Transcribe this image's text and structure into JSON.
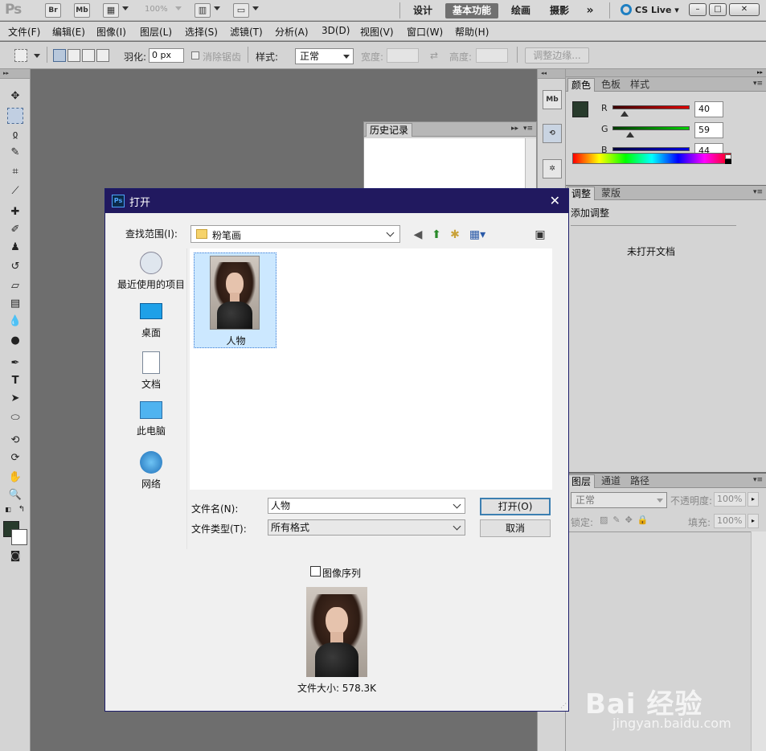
{
  "app": {
    "logo": "Ps",
    "bridge_btn": "Br",
    "mini_bridge_btn": "Mb",
    "zoom": "100%",
    "workspaces": [
      "设计",
      "基本功能",
      "绘画",
      "摄影"
    ],
    "workspace_more": "»",
    "cs_live": "CS Live"
  },
  "menu": [
    "文件(F)",
    "编辑(E)",
    "图像(I)",
    "图层(L)",
    "选择(S)",
    "滤镜(T)",
    "分析(A)",
    "3D(D)",
    "视图(V)",
    "窗口(W)",
    "帮助(H)"
  ],
  "options": {
    "feather_label": "羽化:",
    "feather_value": "0 px",
    "antialias_label": "消除锯齿",
    "style_label": "样式:",
    "style_value": "正常",
    "width_label": "宽度:",
    "height_label": "高度:",
    "refine_edge": "调整边缘..."
  },
  "panels": {
    "color_tabs": [
      "颜色",
      "色板",
      "样式"
    ],
    "rgb": [
      {
        "label": "R",
        "value": "40",
        "fraction": 0.157
      },
      {
        "label": "G",
        "value": "59",
        "fraction": 0.231
      },
      {
        "label": "B",
        "value": "44",
        "fraction": 0.173
      }
    ],
    "fg_color": "#283b2c",
    "adjust_tabs": [
      "调整",
      "蒙版"
    ],
    "adjust_title": "添加调整",
    "no_document": "未打开文档",
    "layer_tabs": [
      "图层",
      "通道",
      "路径"
    ],
    "blend_mode": "正常",
    "opacity_label": "不透明度:",
    "opacity_value": "100%",
    "lock_label": "锁定:",
    "fill_label": "填充:",
    "fill_value": "100%",
    "history_title": "历史记录"
  },
  "dialog": {
    "title": "打开",
    "look_in_label": "查找范围(I):",
    "look_in_value": "粉笔画",
    "places": [
      "最近使用的项目",
      "桌面",
      "文档",
      "此电脑",
      "网络"
    ],
    "files": [
      {
        "name": "人物"
      }
    ],
    "filename_label": "文件名(N):",
    "filename_value": "人物",
    "filetype_label": "文件类型(T):",
    "filetype_value": "所有格式",
    "open_button": "打开(O)",
    "cancel_button": "取消",
    "image_sequence": "图像序列",
    "file_size": "文件大小: 578.3K"
  },
  "watermark": {
    "main": "Bai 经验",
    "sub": "jingyan.baidu.com"
  }
}
